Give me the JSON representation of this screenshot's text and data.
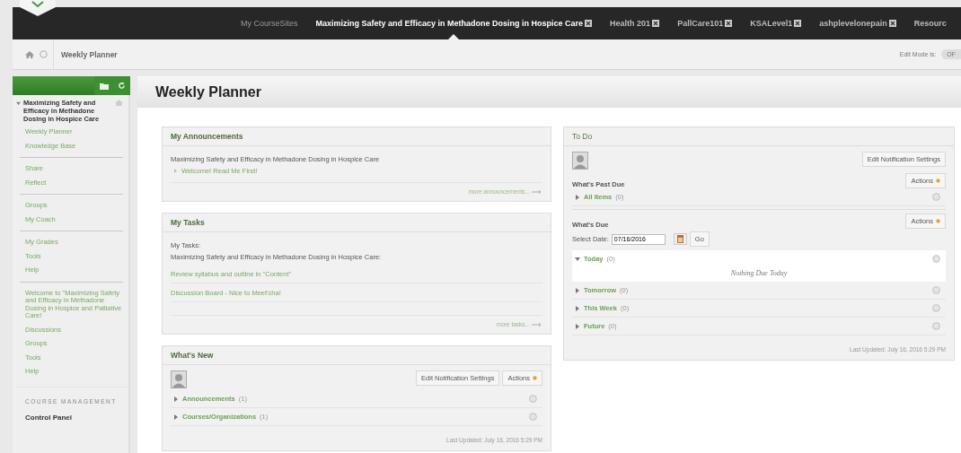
{
  "top_nav": {
    "tabs": [
      {
        "label": "My CourseSites",
        "selected": false,
        "closable": false
      },
      {
        "label": "Maximizing Safety and Efficacy in Methadone Dosing in Hospice Care",
        "selected": true,
        "closable": true
      },
      {
        "label": "Health 201",
        "selected": false,
        "closable": true
      },
      {
        "label": "PallCare101",
        "selected": false,
        "closable": true
      },
      {
        "label": "KSALevel1",
        "selected": false,
        "closable": true
      },
      {
        "label": "ashplevelonepain",
        "selected": false,
        "closable": true
      },
      {
        "label": "Resourc",
        "selected": false,
        "closable": false
      }
    ]
  },
  "breadcrumb": {
    "current": "Weekly Planner",
    "edit_mode_label": "Edit Mode is:",
    "edit_mode_toggle": {
      "label": "OF",
      "on": false
    }
  },
  "sidebar": {
    "course_title": "Maximizing Safety and Efficacy in Methadone Dosing in Hospice Care",
    "groups": [
      [
        "Weekly Planner",
        "Knowledge Base"
      ],
      [
        "Share",
        "Reflect"
      ],
      [
        "Groups",
        "My Coach"
      ],
      [
        "My Grades",
        "Tools",
        "Help"
      ],
      [
        "Welcome to \"Maximizing Safety and Efficacy in Methadone Dosing in Hospice and Palliative Care!",
        "Discussions",
        "Groups",
        "Tools",
        "Help"
      ]
    ],
    "section_heading": "COURSE MANAGEMENT",
    "section_items": [
      "Control Panel"
    ]
  },
  "page_title": "Weekly Planner",
  "my_announcements": {
    "title": "My Announcements",
    "course": "Maximizing Safety and Efficacy in Methadone Dosing in Hospice Care",
    "items": [
      "Welcome! Read Me First!"
    ],
    "more": "more announcements..."
  },
  "my_tasks": {
    "title": "My Tasks",
    "intro": "My Tasks:",
    "course": "Maximizing Safety and Efficacy in Methadone Dosing in Hospice Care:",
    "items": [
      "Review syllabus and outline in \"Content\"",
      "Discussion Board - Nice to Meet'cha!"
    ],
    "more": "more tasks..."
  },
  "whats_new": {
    "title": "What's New",
    "notify_button": "Edit Notification Settings",
    "actions": "Actions",
    "rows": [
      {
        "label": "Announcements",
        "count": "(1)",
        "expanded": false
      },
      {
        "label": "Courses/Organizations",
        "count": "(1)",
        "expanded": false
      }
    ],
    "updated": "Last Updated: July 16, 2016 5:29 PM"
  },
  "to_do": {
    "title": "To Do",
    "notify_button": "Edit Notification Settings",
    "past_due": {
      "heading": "What's Past Due",
      "actions": "Actions",
      "rows": [
        {
          "label": "All Items",
          "count": "(0)",
          "expanded": false
        }
      ]
    },
    "due": {
      "heading": "What's Due",
      "actions": "Actions",
      "date_label": "Select Date:",
      "date_value": "07/16/2016",
      "go": "Go",
      "rows": [
        {
          "label": "Today",
          "count": "(0)",
          "expanded": true,
          "empty_text": "Nothing Due Today"
        },
        {
          "label": "Tomorrow",
          "count": "(0)",
          "expanded": false
        },
        {
          "label": "This Week",
          "count": "(0)",
          "expanded": false
        },
        {
          "label": "Future",
          "count": "(0)",
          "expanded": false
        }
      ]
    },
    "updated": "Last Updated: July 16, 2016 5:29 PM"
  }
}
